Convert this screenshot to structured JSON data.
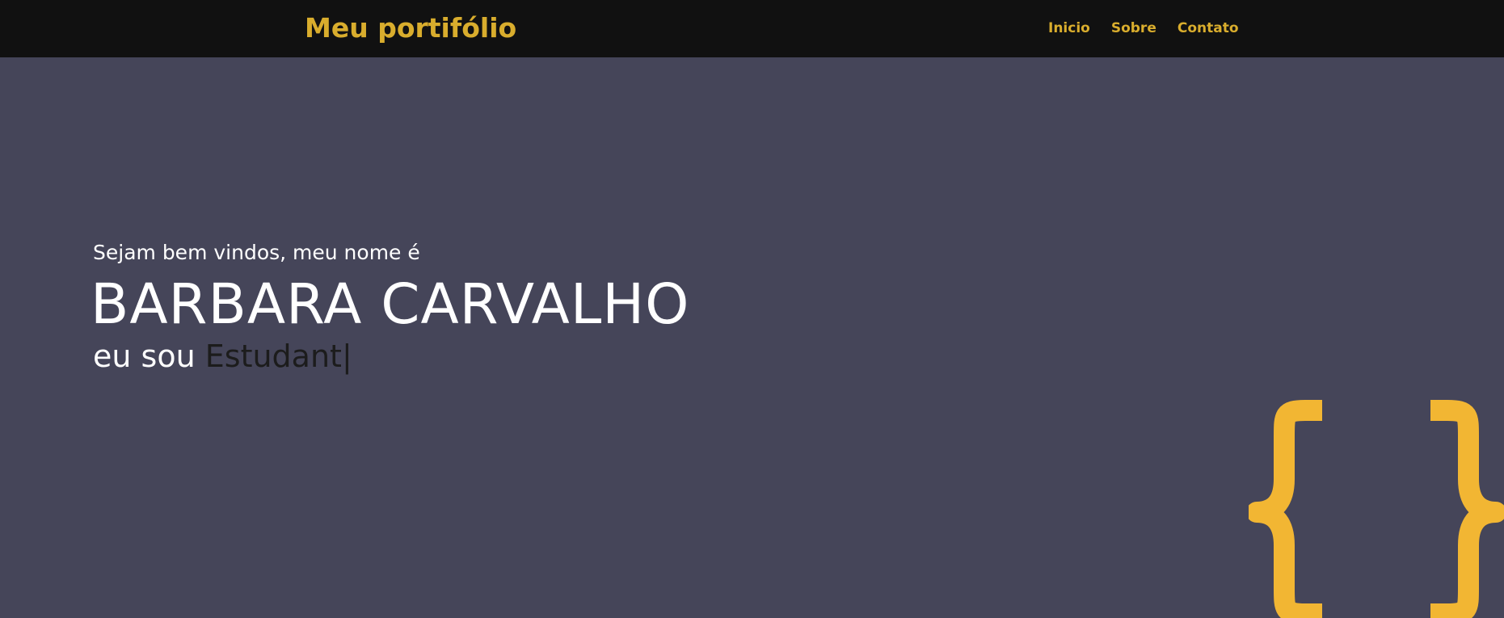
{
  "header": {
    "brand": "Meu portifólio",
    "nav": [
      "Inicio",
      "Sobre",
      "Contato"
    ]
  },
  "hero": {
    "greeting": "Sejam bem vindos, meu nome é",
    "name": "BARBARA CARVALHO",
    "role_prefix": "eu sou ",
    "role_typed": "Estudant",
    "cursor": "|"
  },
  "decor": {
    "icon": "curly-braces-icon"
  },
  "colors": {
    "header_bg": "#111111",
    "accent": "#d9ad2d",
    "page_bg": "#454559",
    "brace": "#f2b633",
    "typed_text": "#1c1c1c"
  }
}
